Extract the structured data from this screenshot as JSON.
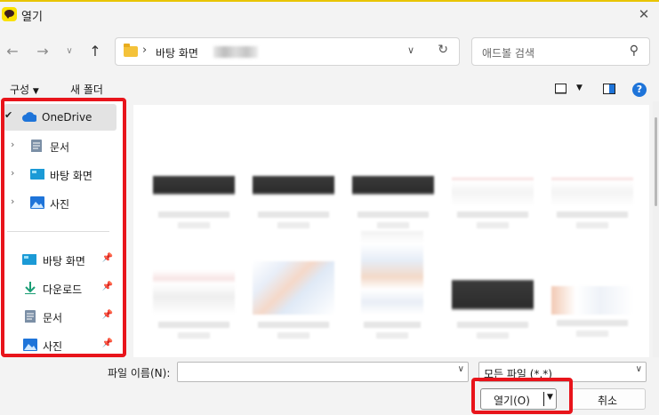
{
  "window": {
    "title": "열기"
  },
  "address": {
    "crumb": "바탕 화면"
  },
  "search": {
    "placeholder": "애드볼 검색"
  },
  "toolbar": {
    "organize_label": "구성",
    "new_folder_label": "새 폴더"
  },
  "sidebar": {
    "items": [
      {
        "label": "OneDrive",
        "icon": "cloud-icon"
      },
      {
        "label": "문서",
        "icon": "document-icon"
      },
      {
        "label": "바탕 화면",
        "icon": "desktop-icon"
      },
      {
        "label": "사진",
        "icon": "pictures-icon"
      }
    ],
    "quick_access": [
      {
        "label": "바탕 화면",
        "icon": "desktop-icon"
      },
      {
        "label": "다운로드",
        "icon": "download-icon"
      },
      {
        "label": "문서",
        "icon": "document-icon"
      },
      {
        "label": "사진",
        "icon": "pictures-icon"
      }
    ]
  },
  "bottom": {
    "filename_label": "파일 이름(N):",
    "filename_value": "",
    "filter_value": "모든 파일 (*.*)",
    "open_label": "열기(O)",
    "cancel_label": "취소"
  },
  "colors": {
    "highlight": "#e8141b",
    "accent": "#1e74d9",
    "onedrive": "#1e74d9"
  }
}
